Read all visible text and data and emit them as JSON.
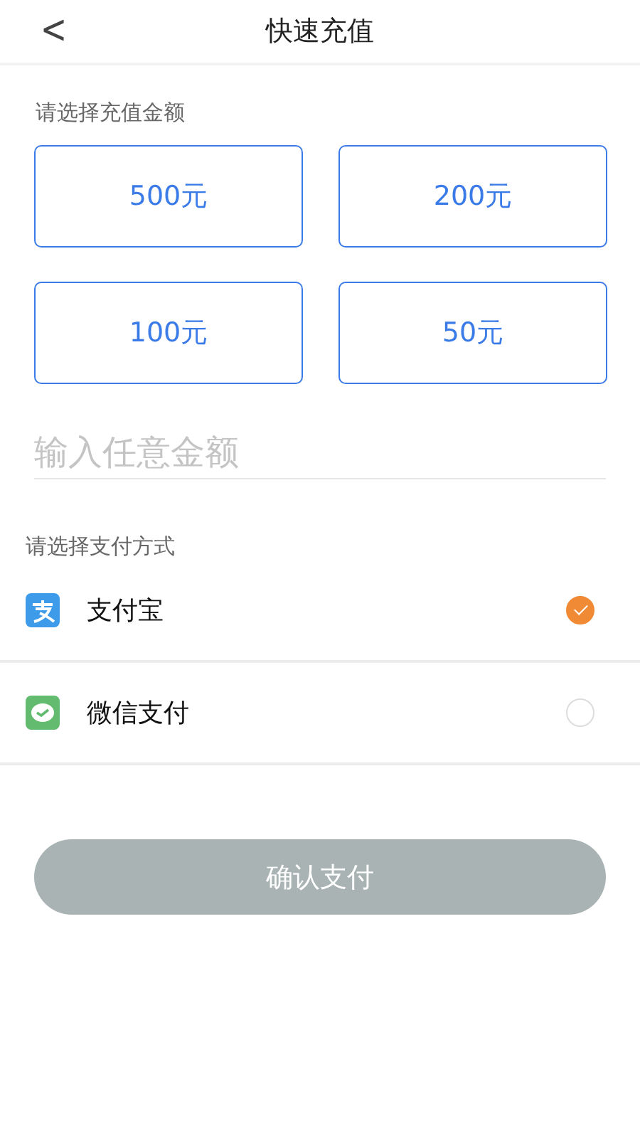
{
  "header": {
    "back": "<",
    "title": "快速充值"
  },
  "amount_section": {
    "label": "请选择充值金额",
    "amounts": [
      {
        "label": "500元"
      },
      {
        "label": "200元"
      },
      {
        "label": "100元"
      },
      {
        "label": "50元"
      }
    ],
    "custom_amount": {
      "placeholder": "输入任意金额"
    }
  },
  "payment_section": {
    "label": "请选择支付方式",
    "methods": [
      {
        "kind": "alipay",
        "name": "支付宝",
        "selected": true
      },
      {
        "kind": "wechat",
        "name": "微信支付",
        "selected": false
      }
    ]
  },
  "confirm_button": {
    "label": "确认支付",
    "disabled": true
  }
}
